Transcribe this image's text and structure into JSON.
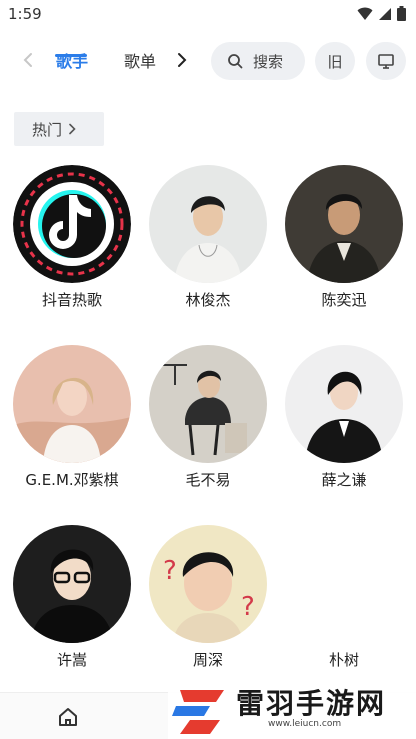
{
  "status": {
    "time": "1:59"
  },
  "nav": {
    "tabs": [
      "歌手",
      "歌单"
    ],
    "search_label": "搜索",
    "old_label": "旧"
  },
  "hot": {
    "label": "热门"
  },
  "artists": [
    {
      "name": "抖音热歌"
    },
    {
      "name": "林俊杰"
    },
    {
      "name": "陈奕迅"
    },
    {
      "name": "G.E.M.邓紫棋"
    },
    {
      "name": "毛不易"
    },
    {
      "name": "薛之谦"
    },
    {
      "name": "许嵩"
    },
    {
      "name": "周深"
    },
    {
      "name": "朴树"
    }
  ],
  "bottom": {
    "home_icon": "home-icon"
  },
  "watermark": {
    "title": "雷羽手游网",
    "url": "www.leiucn.com"
  },
  "colors": {
    "accent": "#2b7de9",
    "pill_bg": "#eef0f3"
  }
}
